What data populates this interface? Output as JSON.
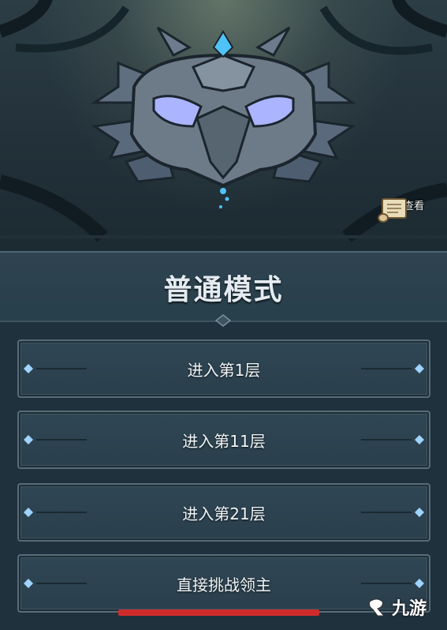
{
  "drop_button": {
    "label": "掉落查看",
    "icon": "scroll-icon"
  },
  "mode": {
    "title": "普通模式"
  },
  "floors": [
    {
      "label": "进入第1层"
    },
    {
      "label": "进入第11层"
    },
    {
      "label": "进入第21层"
    },
    {
      "label": "直接挑战领主"
    }
  ],
  "watermark": {
    "text": "九游",
    "icon": "jiuyou-logo-icon"
  },
  "colors": {
    "background": "#1d2e38",
    "button_fill": "#2f4654",
    "button_border": "#566c78",
    "accent_gem": "#4fc3f7",
    "eye_glow": "#9aa7ff",
    "progress": "#cf2b2b"
  }
}
